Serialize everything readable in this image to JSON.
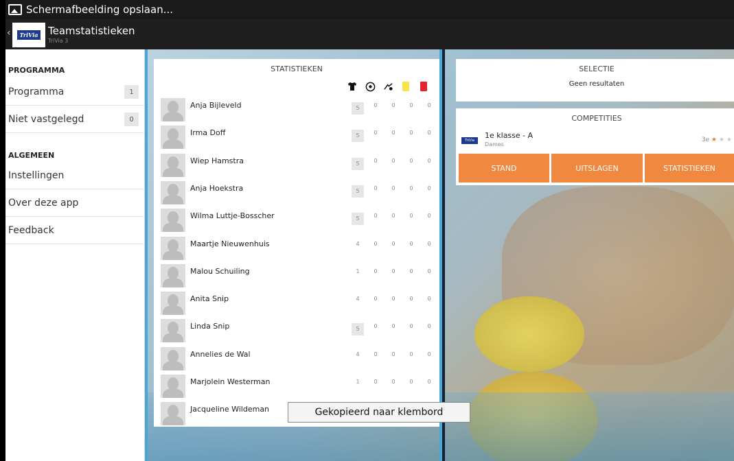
{
  "statusbar": {
    "title": "Schermafbeelding opslaan..."
  },
  "actionbar": {
    "back": "‹",
    "logo_text": "TriVia",
    "title": "Teamstatistieken",
    "subtitle": "TriVia 3"
  },
  "sidebar": {
    "programma_header": "PROGRAMMA",
    "algemeen_header": "ALGEMEEN",
    "items": [
      {
        "label": "Programma",
        "count": "1"
      },
      {
        "label": "Niet vastgelegd",
        "count": "0"
      },
      {
        "label": "Instellingen"
      },
      {
        "label": "Over deze app"
      },
      {
        "label": "Feedback"
      }
    ]
  },
  "stats": {
    "title": "STATISTIEKEN",
    "icons": [
      "shirt-icon",
      "ball-icon",
      "assist-icon",
      "yellow-card-icon",
      "red-card-icon"
    ],
    "players": [
      {
        "name": "Anja Bijleveld",
        "v": [
          "5",
          "0",
          "0",
          "0",
          "0"
        ],
        "hl": true
      },
      {
        "name": "Irma Doff",
        "v": [
          "5",
          "0",
          "0",
          "0",
          "0"
        ],
        "hl": true
      },
      {
        "name": "Wiep Hamstra",
        "v": [
          "5",
          "0",
          "0",
          "0",
          "0"
        ],
        "hl": true
      },
      {
        "name": "Anja Hoekstra",
        "v": [
          "5",
          "0",
          "0",
          "0",
          "0"
        ],
        "hl": true
      },
      {
        "name": "Wilma Luttje-Bosscher",
        "v": [
          "5",
          "0",
          "0",
          "0",
          "0"
        ],
        "hl": true
      },
      {
        "name": "Maartje Nieuwenhuis",
        "v": [
          "4",
          "0",
          "0",
          "0",
          "0"
        ],
        "hl": false
      },
      {
        "name": "Malou Schuiling",
        "v": [
          "1",
          "0",
          "0",
          "0",
          "0"
        ],
        "hl": false
      },
      {
        "name": "Anita Snip",
        "v": [
          "4",
          "0",
          "0",
          "0",
          "0"
        ],
        "hl": false
      },
      {
        "name": "Linda Snip",
        "v": [
          "5",
          "0",
          "0",
          "0",
          "0"
        ],
        "hl": true
      },
      {
        "name": "Annelies de Wal",
        "v": [
          "4",
          "0",
          "0",
          "0",
          "0"
        ],
        "hl": false
      },
      {
        "name": "Marjolein Westerman",
        "v": [
          "1",
          "0",
          "0",
          "0",
          "0"
        ],
        "hl": false
      },
      {
        "name": "Jacqueline Wildeman",
        "v": [
          "",
          "",
          "",
          "",
          ""
        ],
        "hl": false
      }
    ]
  },
  "toast": {
    "text": "Gekopieerd naar klembord"
  },
  "selectie": {
    "title": "SELECTIE",
    "empty": "Geen resultaten"
  },
  "competities": {
    "title": "COMPETITIES",
    "logo_text": "TriVia",
    "name": "1e klasse - A",
    "sub": "Dames",
    "rank": "3e",
    "stars_filled": 1,
    "stars_total": 3,
    "buttons": [
      "STAND",
      "UITSLAGEN",
      "STATISTIEKEN"
    ],
    "accent": "#f0883f"
  }
}
